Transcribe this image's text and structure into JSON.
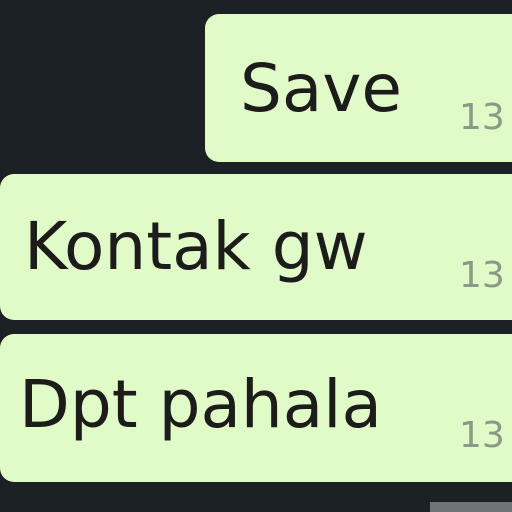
{
  "messages": [
    {
      "text": "Save",
      "time": "13"
    },
    {
      "text": "Kontak gw",
      "time": "13"
    },
    {
      "text": "Dpt pahala",
      "time": "13"
    }
  ],
  "colors": {
    "background": "#1b2124",
    "outgoing_bubble": "#e1fbc8",
    "message_text": "#1c1d1b",
    "timestamp": "#8a9a86"
  }
}
